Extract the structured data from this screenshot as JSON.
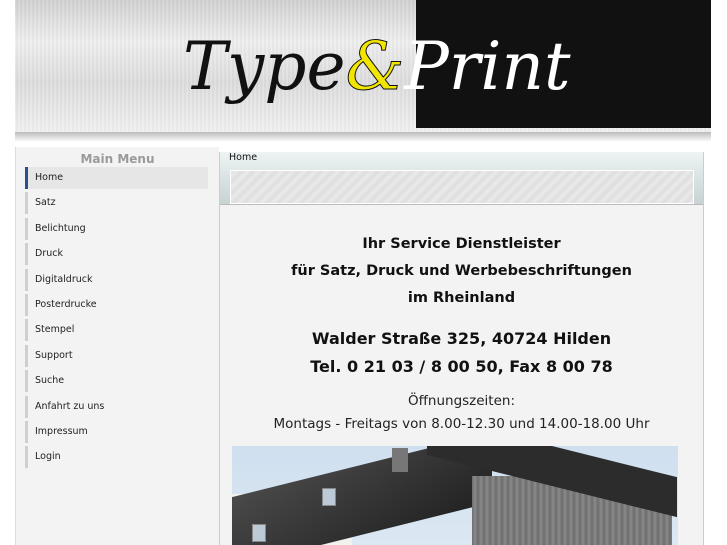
{
  "header": {
    "logo_type": "Type",
    "logo_amp": "&",
    "logo_print": "Print"
  },
  "menu": {
    "title": "Main Menu",
    "items": [
      {
        "label": "Home",
        "active": true
      },
      {
        "label": "Satz"
      },
      {
        "label": "Belichtung"
      },
      {
        "label": "Druck"
      },
      {
        "label": "Digitaldruck"
      },
      {
        "label": "Posterdrucke"
      },
      {
        "label": "Stempel"
      },
      {
        "label": "Support"
      },
      {
        "label": "Suche"
      },
      {
        "label": "Anfahrt zu uns"
      },
      {
        "label": "Impressum"
      },
      {
        "label": "Login"
      }
    ]
  },
  "breadcrumb": {
    "current": "Home"
  },
  "content": {
    "line1": "Ihr Service Dienstleister",
    "line2": "für Satz, Druck und Werbebeschriftungen",
    "line3": "im Rheinland",
    "address": "Walder Straße 325, 40724 Hilden",
    "phone": "Tel. 0 21 03 / 8 00 50, Fax 8 00 78",
    "hours_label": "Öffnungszeiten:",
    "hours": "Montags - Freitags von 8.00-12.30 und 14.00-18.00 Uhr"
  },
  "colors": {
    "active_accent": "#2a4f8f",
    "amp_yellow": "#f2e600"
  }
}
